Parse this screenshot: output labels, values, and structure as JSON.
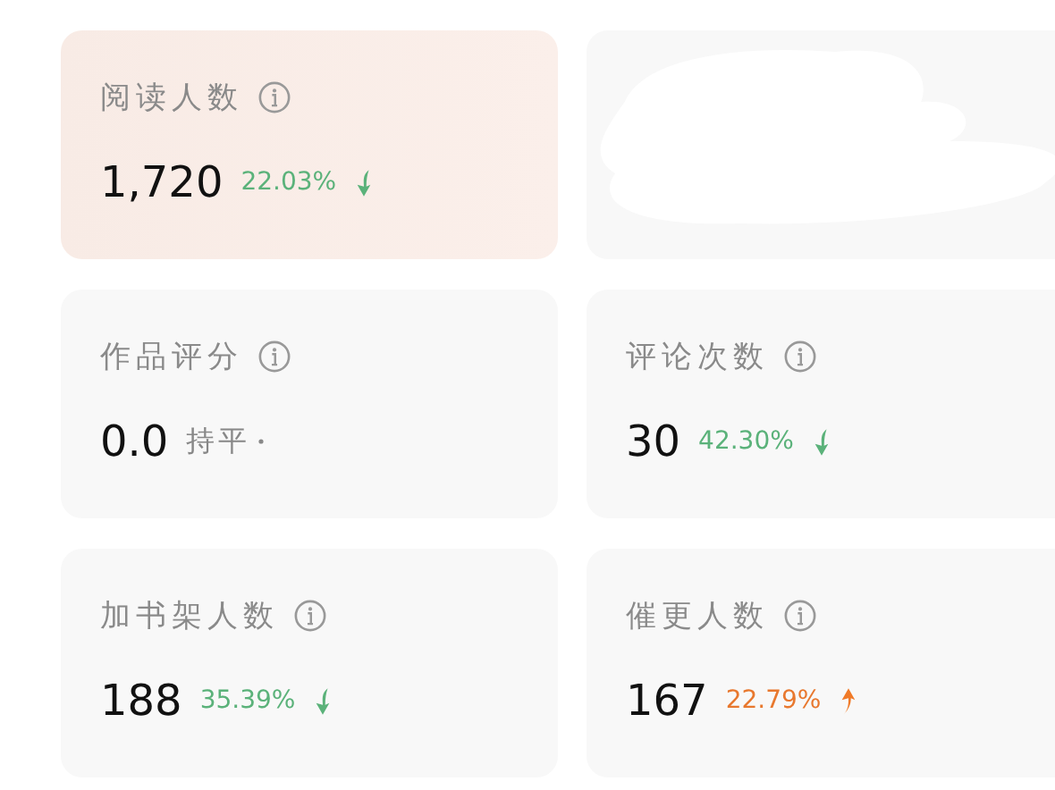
{
  "cards": [
    {
      "kind": "metric",
      "label": "阅读人数",
      "value": "1,720",
      "change": {
        "text": "22.03%",
        "kind": "down"
      },
      "highlighted": true
    },
    {
      "kind": "hidden"
    },
    {
      "kind": "metric",
      "label": "作品评分",
      "value": "0.0",
      "change": {
        "text": "持平",
        "kind": "flat"
      },
      "highlighted": false
    },
    {
      "kind": "metric",
      "label": "评论次数",
      "value": "30",
      "change": {
        "text": "42.30%",
        "kind": "down"
      },
      "highlighted": false
    },
    {
      "kind": "metric",
      "label": "加书架人数",
      "value": "188",
      "change": {
        "text": "35.39%",
        "kind": "down"
      },
      "highlighted": false
    },
    {
      "kind": "metric",
      "label": "催更人数",
      "value": "167",
      "change": {
        "text": "22.79%",
        "kind": "up"
      },
      "highlighted": false
    }
  ]
}
